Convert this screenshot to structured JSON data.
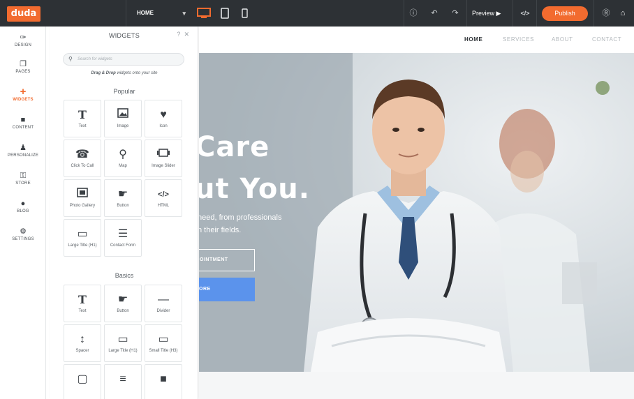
{
  "topbar": {
    "logo": "duda",
    "page_select": "HOME",
    "preview_label": "Preview ▶",
    "publish_label": "Publish",
    "code_icon": "</>",
    "accent": "#f26b2f"
  },
  "leftnav": {
    "items": [
      {
        "label": "DESIGN",
        "icon": "brush-icon"
      },
      {
        "label": "PAGES",
        "icon": "pages-icon"
      },
      {
        "label": "WIDGETS",
        "icon": "plus-icon"
      },
      {
        "label": "CONTENT",
        "icon": "folder-icon"
      },
      {
        "label": "PERSONALIZE",
        "icon": "person-icon"
      },
      {
        "label": "STORE",
        "icon": "cart-icon"
      },
      {
        "label": "BLOG",
        "icon": "chat-icon"
      },
      {
        "label": "SETTINGS",
        "icon": "gear-icon"
      }
    ]
  },
  "panel": {
    "title": "WIDGETS",
    "help": "?",
    "close": "✕",
    "search_placeholder": "Search for widgets",
    "drag_hint_bold": "Drag & Drop",
    "drag_hint_rest": " widgets onto your site",
    "popular_title": "Popular",
    "popular": [
      {
        "label": "Text",
        "glyph": "T"
      },
      {
        "label": "Image",
        "glyph": "🖼"
      },
      {
        "label": "Icon",
        "glyph": "♥"
      },
      {
        "label": "Click To Call",
        "glyph": "☎"
      },
      {
        "label": "Map",
        "glyph": "⚲"
      },
      {
        "label": "Image Slider",
        "glyph": "▣"
      },
      {
        "label": "Photo Gallery",
        "glyph": "▤"
      },
      {
        "label": "Button",
        "glyph": "☛"
      },
      {
        "label": "HTML",
        "glyph": "</>"
      },
      {
        "label": "Large Title (H1)",
        "glyph": "▭"
      },
      {
        "label": "Contact Form",
        "glyph": "☰"
      }
    ],
    "basics_title": "Basics",
    "basics": [
      {
        "label": "Text",
        "glyph": "T"
      },
      {
        "label": "Button",
        "glyph": "☛"
      },
      {
        "label": "Divider",
        "glyph": "—"
      },
      {
        "label": "Spacer",
        "glyph": "↕"
      },
      {
        "label": "Large Title (H1)",
        "glyph": "▭"
      },
      {
        "label": "Small Title (H3)",
        "glyph": "▭"
      },
      {
        "label": "",
        "glyph": "▢"
      },
      {
        "label": "",
        "glyph": "≡"
      },
      {
        "label": "",
        "glyph": "■"
      }
    ]
  },
  "site": {
    "nav": [
      "HOME",
      "SERVICES",
      "ABOUT",
      "CONTACT"
    ],
    "hero_title_1": "Care",
    "hero_title_2": "ut You.",
    "hero_text_1": "need, from professionals",
    "hero_text_2": "n their fields.",
    "btn_outline": "OINTMENT",
    "btn_blue": "ORE",
    "blue": "#5b93ec"
  }
}
